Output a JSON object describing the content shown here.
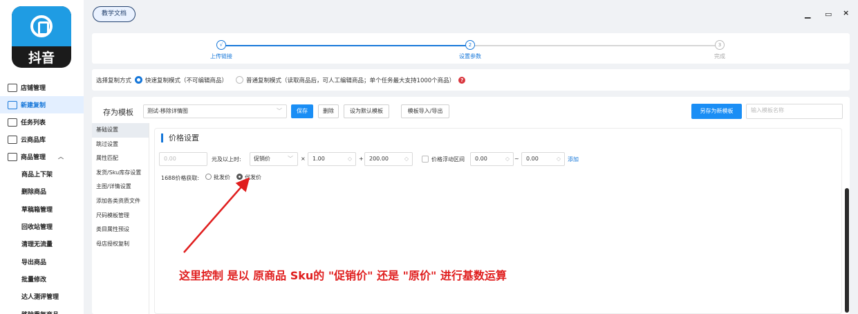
{
  "app": {
    "logo_text": "抖音"
  },
  "topbar": {
    "doc_button": "教学文档",
    "min": "▁",
    "max": "▭",
    "close": "×"
  },
  "sidebar": {
    "items": [
      {
        "label": "店铺管理",
        "icon": "store-icon"
      },
      {
        "label": "新建复制",
        "icon": "new-copy-icon",
        "active": true
      },
      {
        "label": "任务列表",
        "icon": "task-list-icon"
      },
      {
        "label": "云商品库",
        "icon": "cloud-library-icon"
      },
      {
        "label": "商品管理",
        "icon": "product-manage-icon",
        "caret": "︿"
      }
    ],
    "sub_items": [
      "商品上下架",
      "删除商品",
      "草稿箱管理",
      "回收站管理",
      "清理无流量",
      "导出商品",
      "批量修改",
      "达人测评管理",
      "移除重复商品"
    ]
  },
  "steps": [
    {
      "num": "√",
      "label": "上传链接"
    },
    {
      "num": "2",
      "label": "设置参数"
    },
    {
      "num": "3",
      "label": "完成"
    }
  ],
  "copy_mode": {
    "label": "选择复制方式",
    "option_fast": "快速复制模式（不可编辑商品）",
    "option_normal": "普通复制模式（读取商品后，可人工编辑商品；单个任务最大支持1000个商品）",
    "help_icon": "?"
  },
  "template": {
    "label": "存为模板",
    "selected": "测试-移除详情图",
    "save": "保存",
    "delete": "删除",
    "set_default": "设为默认模板",
    "import_export": "模板导入/导出",
    "save_as_new": "另存为新模板",
    "name_placeholder": "输入模板名称"
  },
  "subnav": [
    "基础设置",
    "跳过设置",
    "属性匹配",
    "发货/Sku库存设置",
    "主图/详情设置",
    "添加各类资质文件",
    "尺码模板管理",
    "类目属性预设",
    "母店授权复制"
  ],
  "price": {
    "title": "价格设置",
    "threshold": "0.00",
    "threshold_suffix": "元及以上时:",
    "price_type": "促销价",
    "times": "×",
    "multiplier": "1.00",
    "plus": "+",
    "addend": "200.00",
    "float_label": "价格浮动区间",
    "float_min": "0.00",
    "tilde": "~",
    "float_max": "0.00",
    "add_link": "添加",
    "source_label": "1688价格获取:",
    "source_wholesale": "批发价",
    "source_dropship": "代发价"
  },
  "annotation": "这里控制 是以 原商品 Sku的 \"促销价\" 还是 \"原价\" 进行基数运算",
  "colors": {
    "accent": "#1677d9",
    "annotation": "#e01e1e"
  }
}
